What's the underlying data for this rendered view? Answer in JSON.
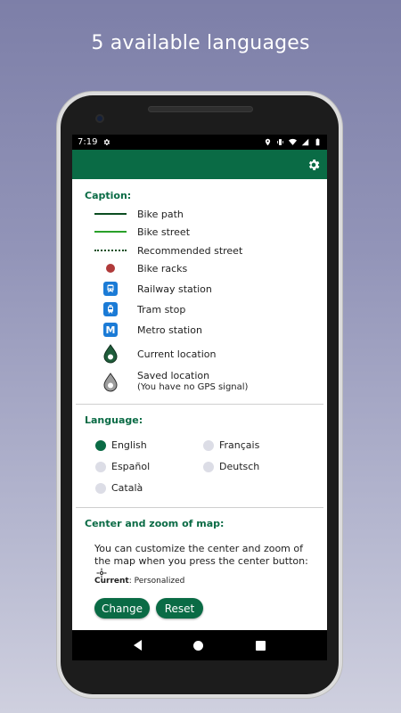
{
  "promo": {
    "title": "5 available languages"
  },
  "status_bar": {
    "time": "7:19"
  },
  "app_bar": {
    "settings_icon": "gear-icon"
  },
  "caption": {
    "title": "Caption:",
    "items": [
      {
        "symbol": "line-solid-dark",
        "label": "Bike path"
      },
      {
        "symbol": "line-solid-light",
        "label": "Bike street"
      },
      {
        "symbol": "line-dotted",
        "label": "Recommended street"
      },
      {
        "symbol": "red-dot",
        "label": "Bike racks"
      },
      {
        "symbol": "train-icon",
        "label": "Railway station"
      },
      {
        "symbol": "tram-icon",
        "label": "Tram stop"
      },
      {
        "symbol": "metro-icon",
        "label": "Metro station",
        "badge_text": "M"
      },
      {
        "symbol": "current-location-pin-icon",
        "label": "Current location"
      },
      {
        "symbol": "saved-location-pin-icon",
        "label": "Saved location",
        "sub_label": "(You have no GPS signal)"
      }
    ]
  },
  "language": {
    "title": "Language:",
    "options": [
      {
        "label": "English",
        "selected": true
      },
      {
        "label": "Français",
        "selected": false
      },
      {
        "label": "Español",
        "selected": false
      },
      {
        "label": "Deutsch",
        "selected": false
      },
      {
        "label": "Català",
        "selected": false
      }
    ]
  },
  "center_zoom": {
    "title": "Center and zoom of map:",
    "description": "You can customize the center and zoom of the map when you press the center button:",
    "center_icon": "crosshair-icon",
    "current_label": "Current",
    "current_value": ": Personalized",
    "change_label": "Change",
    "reset_label": "Reset"
  },
  "colors": {
    "accent": "#0a6b45",
    "bike_path": "#0b4d21",
    "bike_street": "#2aa02a",
    "bike_racks": "#b03a3a",
    "transit_badge": "#1b7bd6"
  }
}
